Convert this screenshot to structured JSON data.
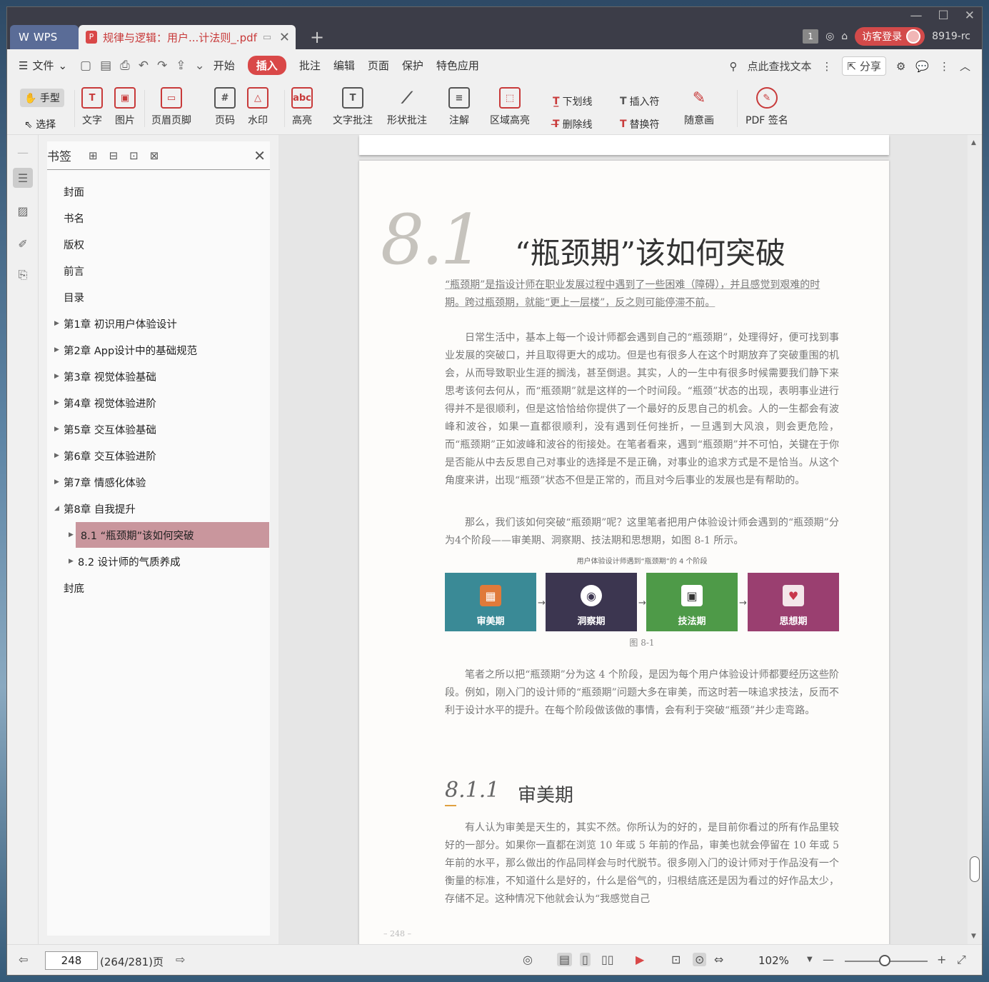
{
  "titlebar": {
    "app_tab": "WPS",
    "doc_tab": "规律与逻辑：用户...计法则_.pdf",
    "page_badge": "1",
    "login_label": "访客登录",
    "user_id": "8919-rc"
  },
  "menu": {
    "file": "文件",
    "tabs": [
      "开始",
      "插入",
      "批注",
      "编辑",
      "页面",
      "保护",
      "特色应用"
    ],
    "active_tab": "插入",
    "search": "点此查找文本",
    "share": "分享"
  },
  "ribbon": {
    "hand": "手型",
    "select": "选择",
    "text": "文字",
    "image": "图片",
    "header_footer": "页眉页脚",
    "page_num": "页码",
    "watermark": "水印",
    "highlight": "高亮",
    "text_note": "文字批注",
    "shape_note": "形状批注",
    "annotation": "注解",
    "area_highlight": "区域高亮",
    "underline": "下划线",
    "strikethrough": "删除线",
    "insert_mark": "插入符",
    "replace_mark": "替换符",
    "freehand": "随意画",
    "pdf_sign": "PDF 签名"
  },
  "bookmark_panel": {
    "title": "书签",
    "items": [
      "封面",
      "书名",
      "版权",
      "前言",
      "目录",
      "第1章 初识用户体验设计",
      "第2章 App设计中的基础规范",
      "第3章 视觉体验基础",
      "第4章 视觉体验进阶",
      "第5章 交互体验基础",
      "第6章 交互体验进阶",
      "第7章 情感化体验",
      "第8章 自我提升",
      "8.1 “瓶颈期”该如何突破",
      "8.2 设计师的气质养成",
      "封底"
    ]
  },
  "page": {
    "section_number": "8.1",
    "section_title": "“瓶颈期”该如何突破",
    "intro": "“瓶颈期”是指设计师在职业发展过程中遇到了一些困难（障碍），并且感觉到艰难的时期。跨过瓶颈期，就能“更上一层楼”，反之则可能停滞不前。",
    "para1": "日常生活中，基本上每一个设计师都会遇到自己的“瓶颈期”，处理得好，便可找到事业发展的突破口，并且取得更大的成功。但是也有很多人在这个时期放弃了突破重围的机会，从而导致职业生涯的搁浅，甚至倒退。其实，人的一生中有很多时候需要我们静下来思考该何去何从，而“瓶颈期”就是这样的一个时间段。“瓶颈”状态的出现，表明事业进行得并不是很顺利，但是这恰恰给你提供了一个最好的反思自己的机会。人的一生都会有波峰和波谷，如果一直都很顺利，没有遇到任何挫折，一旦遇到大风浪，则会更危险，而“瓶颈期”正如波峰和波谷的衔接处。在笔者看来，遇到“瓶颈期”并不可怕，关键在于你是否能从中去反思自己对事业的选择是不是正确，对事业的追求方式是不是恰当。从这个角度来讲，出现“瓶颈”状态不但是正常的，而且对今后事业的发展也是有帮助的。",
    "para2": "那么，我们该如何突破“瓶颈期”呢？这里笔者把用户体验设计师会遇到的“瓶颈期”分为4个阶段——审美期、洞察期、技法期和思想期，如图 8-1 所示。",
    "figure_caption": "用户体验设计师遇到“瓶颈期”的 4 个阶段",
    "stages": [
      {
        "label": "审美期",
        "color": "#3a8a96"
      },
      {
        "label": "洞察期",
        "color": "#3c3650"
      },
      {
        "label": "技法期",
        "color": "#4e9a48"
      },
      {
        "label": "思想期",
        "color": "#9a3f70"
      }
    ],
    "figure_number": "图 8-1",
    "para3": "笔者之所以把“瓶颈期”分为这 4 个阶段，是因为每个用户体验设计师都要经历这些阶段。例如，刚入门的设计师的“瓶颈期”问题大多在审美，而这时若一味追求技法，反而不利于设计水平的提升。在每个阶段做该做的事情，会有利于突破“瓶颈”并少走弯路。",
    "subsection_number": "8.1.1",
    "subsection_title": "审美期",
    "para4": "有人认为审美是天生的，其实不然。你所认为的好的，是目前你看过的所有作品里较好的一部分。如果你一直都在浏览 10 年或 5 年前的作品，审美也就会停留在 10 年或 5 年前的水平，那么做出的作品同样会与时代脱节。很多刚入门的设计师对于作品没有一个衡量的标准，不知道什么是好的，什么是俗气的，归根结底还是因为看过的好作品太少，存储不足。这种情况下他就会认为“我感觉自己",
    "page_number": "– 248 –"
  },
  "status": {
    "current_page": "248",
    "page_total": "(264/281)页",
    "zoom": "102%"
  },
  "colors": {
    "accent": "#d94848",
    "selected_bookmark": "#c9969d"
  }
}
